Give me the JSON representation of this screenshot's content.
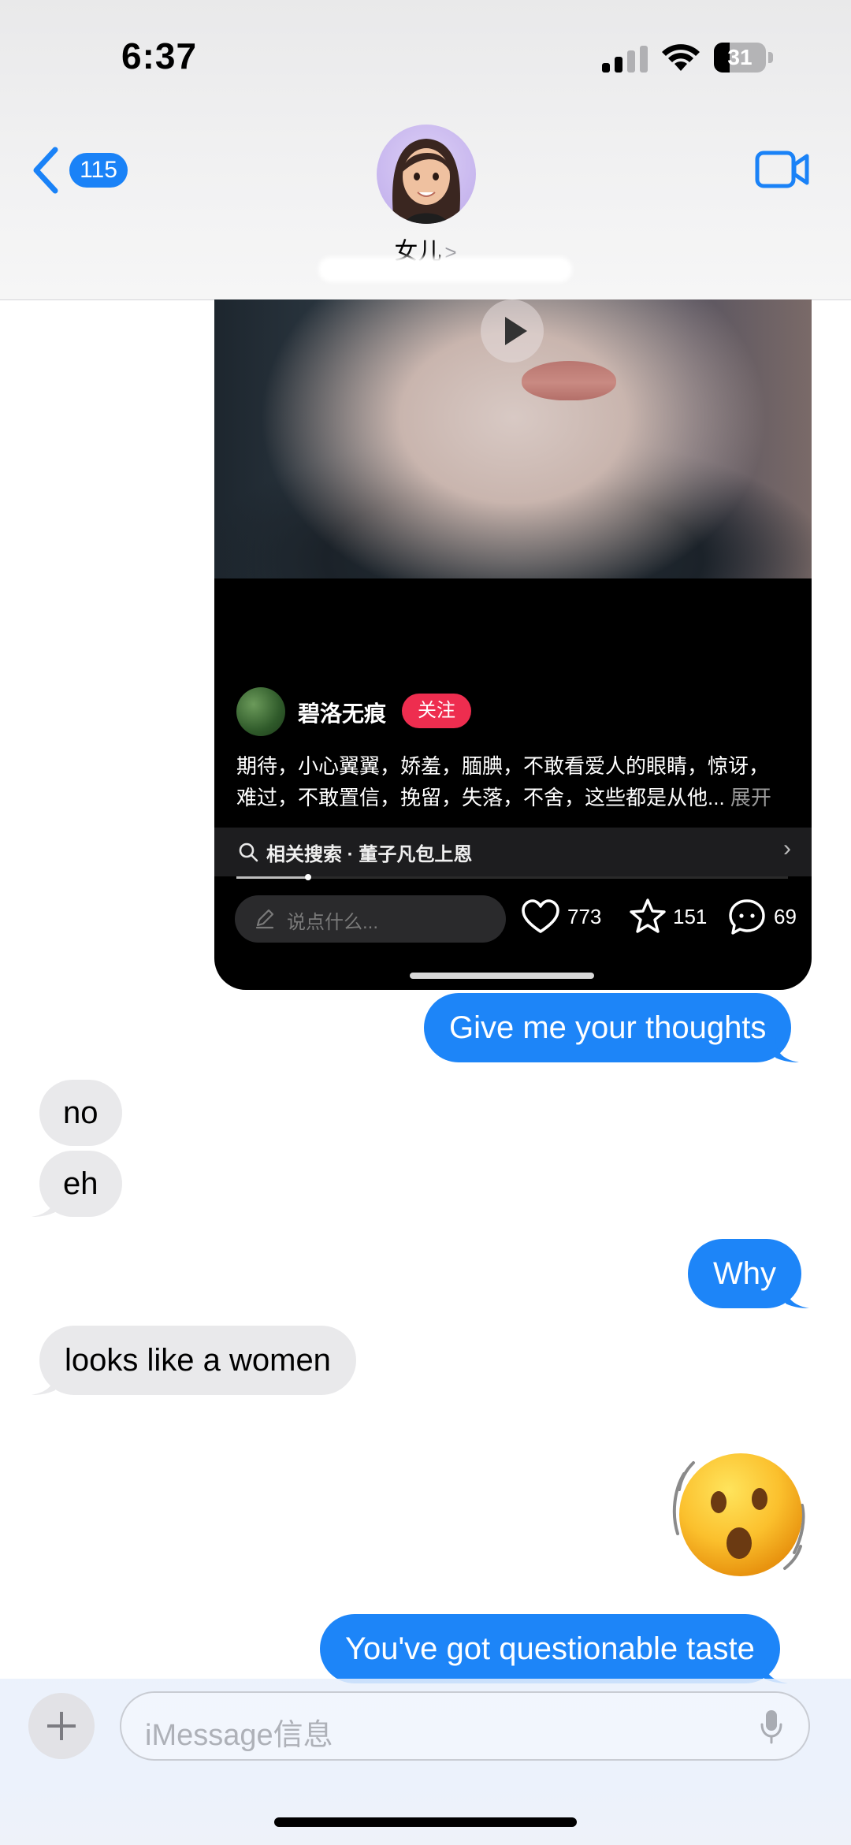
{
  "status_bar": {
    "time": "6:37",
    "battery": "31",
    "battery_level": 0.31
  },
  "header": {
    "back_count": "115",
    "contact_name": "女儿",
    "contact_chevron": ">"
  },
  "video_card": {
    "author": "碧洛无痕",
    "follow_label": "关注",
    "caption_line1": "期待，小心翼翼，娇羞，腼腆，不敢看爱人的眼睛，惊讶，",
    "caption_line2": "难过，不敢置信，挽留，失落，不舍，这些都是从他...",
    "caption_more": "展开",
    "related_search": "相关搜索 · 董子凡包上恩",
    "comment_placeholder": "说点什么...",
    "likes": "773",
    "favorites": "151",
    "comments": "69",
    "progress": 0.13
  },
  "messages": [
    {
      "from": "me",
      "text": "Give me your thoughts"
    },
    {
      "from": "them",
      "text": "no"
    },
    {
      "from": "them",
      "text": "eh"
    },
    {
      "from": "me",
      "text": "Why"
    },
    {
      "from": "them",
      "text": "looks like a women"
    },
    {
      "from": "me",
      "text": "😯",
      "kind": "emoji"
    },
    {
      "from": "me",
      "text": "You've got questionable taste"
    }
  ],
  "input": {
    "placeholder": "iMessage信息"
  },
  "colors": {
    "accent": "#1a82f7",
    "sent_bubble": "#1d85f8",
    "received_bubble": "#e9e9eb",
    "follow": "#ee2d4f"
  }
}
